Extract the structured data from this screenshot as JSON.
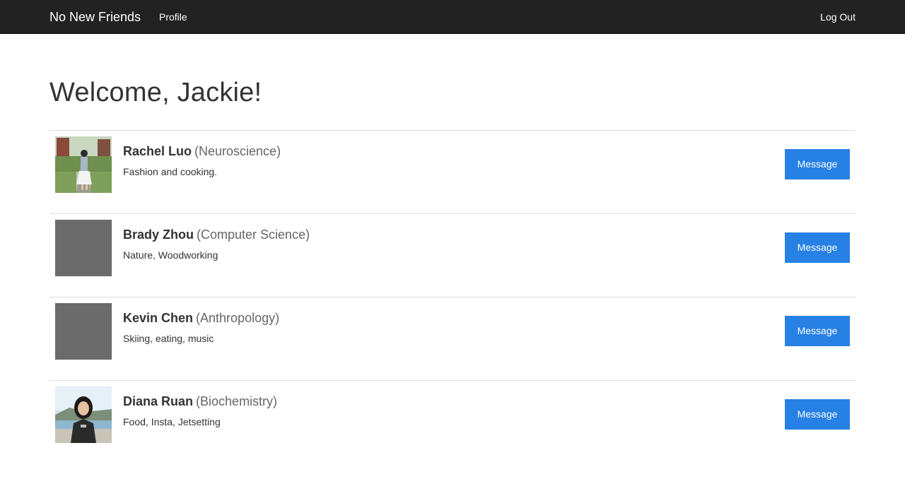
{
  "navbar": {
    "brand": "No New Friends",
    "profile_label": "Profile",
    "logout_label": "Log Out"
  },
  "page": {
    "title": "Welcome, Jackie!"
  },
  "users": [
    {
      "name": "Rachel Luo",
      "major": "(Neuroscience)",
      "interests": "Fashion and cooking.",
      "message_label": "Message",
      "photo": "photo"
    },
    {
      "name": "Brady Zhou",
      "major": "(Computer Science)",
      "interests": "Nature, Woodworking",
      "message_label": "Message",
      "photo": "placeholder"
    },
    {
      "name": "Kevin Chen",
      "major": "(Anthropology)",
      "interests": "Skiing, eating, music",
      "message_label": "Message",
      "photo": "placeholder"
    },
    {
      "name": "Diana Ruan",
      "major": "(Biochemistry)",
      "interests": "Food, Insta, Jetsetting",
      "message_label": "Message",
      "photo": "photo"
    }
  ],
  "colors": {
    "navbar_bg": "#222222",
    "button_bg": "#2780e3",
    "placeholder_avatar": "#6b6b6b"
  }
}
